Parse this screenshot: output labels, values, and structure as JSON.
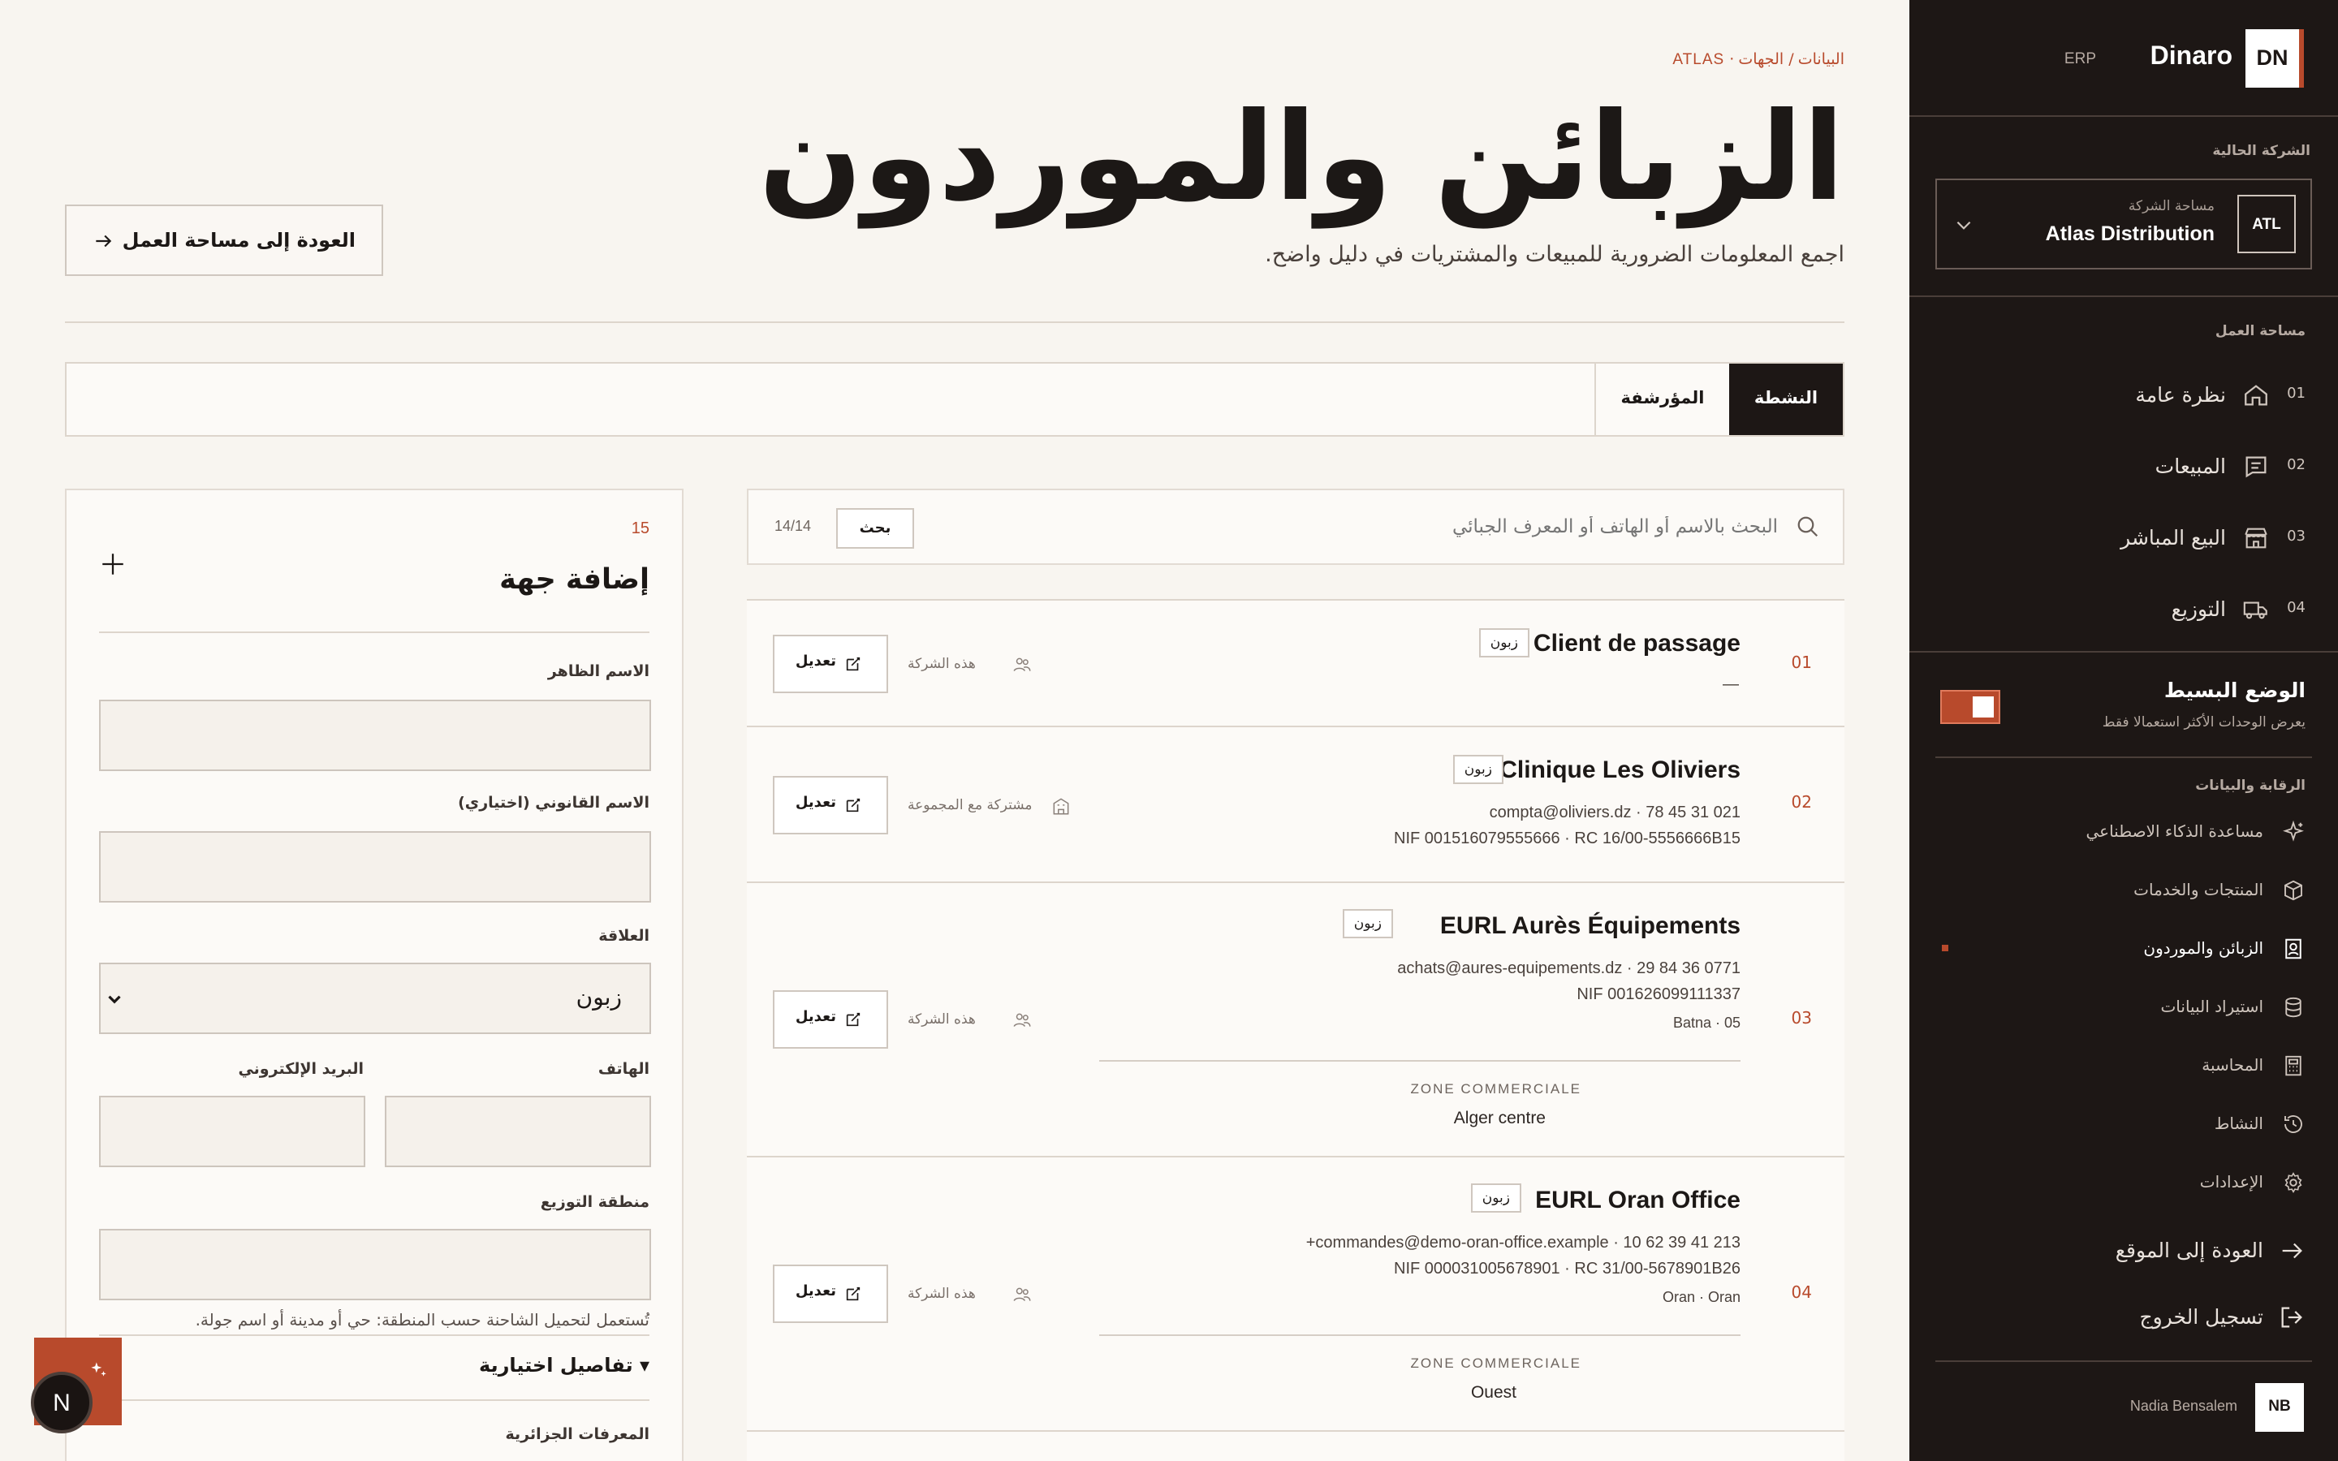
{
  "sidebar": {
    "logo_badge": "DN",
    "brand": "Dinaro",
    "brand_suffix": "ERP",
    "company_section_title": "الشركة الحالية",
    "company_workspace_label": "مساحة الشركة",
    "company_name": "Atlas Distribution",
    "company_badge": "ATL",
    "workspace_title": "مساحة العمل",
    "nav": [
      {
        "num": "01",
        "label": "نظرة عامة",
        "icon": "home-icon"
      },
      {
        "num": "02",
        "label": "المبيعات",
        "icon": "receipt-icon"
      },
      {
        "num": "03",
        "label": "البيع المباشر",
        "icon": "store-icon"
      },
      {
        "num": "04",
        "label": "التوزيع",
        "icon": "truck-icon"
      }
    ],
    "simple_mode_title": "الوضع البسيط",
    "simple_mode_desc": "يعرض الوحدات الأكثر استعمالا فقط",
    "simple_mode_on": true,
    "control_title": "الرقابة والبيانات",
    "sub_nav": [
      {
        "label": "مساعدة الذكاء الاصطناعي",
        "icon": "sparkle-icon",
        "active": false
      },
      {
        "label": "المنتجات والخدمات",
        "icon": "box-icon",
        "active": false
      },
      {
        "label": "الزبائن والموردون",
        "icon": "contacts-icon",
        "active": true
      },
      {
        "label": "استيراد البيانات",
        "icon": "database-icon",
        "active": false
      },
      {
        "label": "المحاسبة",
        "icon": "calculator-icon",
        "active": false
      },
      {
        "label": "النشاط",
        "icon": "history-icon",
        "active": false
      },
      {
        "label": "الإعدادات",
        "icon": "gear-icon",
        "active": false
      }
    ],
    "back_to_site": "العودة إلى الموقع",
    "logout": "تسجيل الخروج",
    "user_name": "Nadia Bensalem",
    "user_initials": "NB",
    "accent": "#b84a2c"
  },
  "header": {
    "breadcrumb": [
      "البيانات",
      "الجهات"
    ],
    "breadcrumb_tag": "ATLAS",
    "title": "الزبائن والموردون",
    "subtitle": "اجمع المعلومات الضرورية للمبيعات والمشتريات في دليل واضح.",
    "back_button": "العودة إلى مساحة العمل"
  },
  "tabs": [
    {
      "label": "النشطة",
      "active": true
    },
    {
      "label": "المؤرشفة",
      "active": false
    }
  ],
  "search": {
    "placeholder": "البحث بالاسم أو الهاتف أو المعرف الجبائي",
    "button": "بحث",
    "count": "14/14"
  },
  "contacts": [
    {
      "idx": "01",
      "name": "Client de passage",
      "tag": "زبون",
      "lines": [
        "—"
      ],
      "scope": "هذه الشركة",
      "scope_icon": "group-icon",
      "edit": "تعديل"
    },
    {
      "idx": "02",
      "name": "Clinique Les Oliviers",
      "tag": "زبون",
      "lines": [
        "compta@oliviers.dz · 78 45 31 021",
        "NIF 001516079555666 · RC 16/00-5556666B15"
      ],
      "scope": "مشتركة مع المجموعة",
      "scope_icon": "building-icon",
      "edit": "تعديل"
    },
    {
      "idx": "03",
      "name": "EURL Aurès Équipements",
      "tag": "زبون",
      "lines": [
        "achats@aures-equipements.dz · 29 84 36 0771",
        "NIF 001626099111337",
        "Batna · 05"
      ],
      "scope": "هذه الشركة",
      "scope_icon": "group-icon",
      "edit": "تعديل",
      "zone_label": "ZONE COMMERCIALE",
      "zone_value": "Alger centre"
    },
    {
      "idx": "04",
      "name": "EURL Oran Office",
      "tag": "زبون",
      "lines": [
        "commandes@demo-oran-office.example · 10 62 39 41 213+",
        "NIF 000031005678901 · RC 31/00-5678901B26",
        "Oran · Oran"
      ],
      "scope": "هذه الشركة",
      "scope_icon": "group-icon",
      "edit": "تعديل",
      "zone_label": "ZONE COMMERCIALE",
      "zone_value": "Ouest"
    }
  ],
  "form": {
    "count": "15",
    "title": "إضافة جهة",
    "display_name_label": "الاسم الظاهر",
    "legal_name_label": "الاسم القانوني (اختياري)",
    "relation_label": "العلاقة",
    "relation_value": "زبون",
    "phone_label": "الهاتف",
    "email_label": "البريد الإلكتروني",
    "zone_label": "منطقة التوزيع",
    "zone_hint": "تُستعمل لتحميل الشاحنة حسب المنطقة: حي أو مدينة أو اسم جولة.",
    "optional_details": "▾ تفاصيل اختيارية",
    "algerian_ids": "المعرفات الجزائرية"
  },
  "fab": {
    "letter": "N"
  }
}
